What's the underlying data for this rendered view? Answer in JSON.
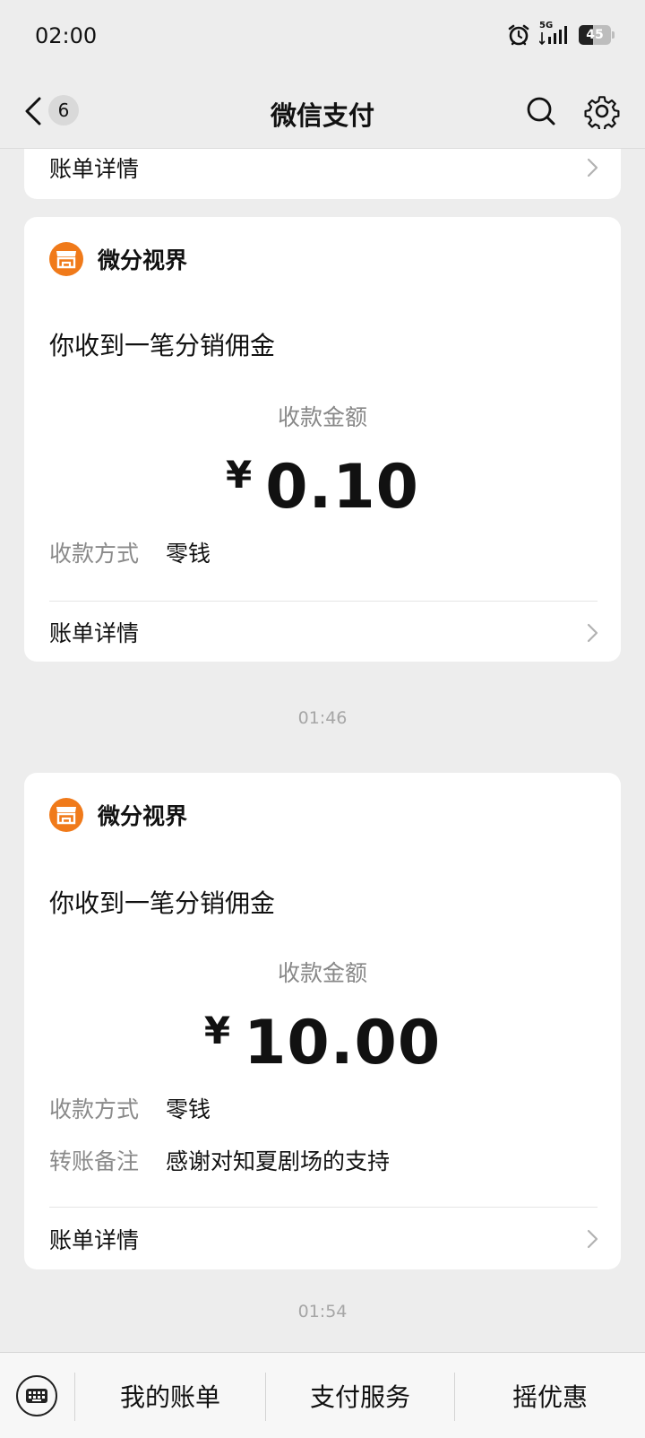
{
  "status_bar": {
    "time": "02:00",
    "network": "5G",
    "battery": "45"
  },
  "nav": {
    "back_count": "6",
    "title": "微信支付"
  },
  "cards": [
    {
      "detail_label": "账单详情"
    },
    {
      "merchant": "微分视界",
      "headline": "你收到一笔分销佣金",
      "amount_label": "收款金额",
      "currency": "¥",
      "amount": "0.10",
      "fields": [
        {
          "key": "收款方式",
          "value": "零钱"
        }
      ],
      "detail_label": "账单详情"
    },
    {
      "merchant": "微分视界",
      "headline": "你收到一笔分销佣金",
      "amount_label": "收款金额",
      "currency": "¥",
      "amount": "10.00",
      "fields": [
        {
          "key": "收款方式",
          "value": "零钱"
        },
        {
          "key": "转账备注",
          "value": "感谢对知夏剧场的支持"
        }
      ],
      "detail_label": "账单详情"
    }
  ],
  "timestamps": [
    "01:46",
    "01:54"
  ],
  "bottom_menu": [
    "我的账单",
    "支付服务",
    "摇优惠"
  ],
  "colors": {
    "background": "#ededed",
    "merchant_logo": "#f07a1a",
    "card": "#ffffff"
  },
  "icons": [
    "alarm-icon",
    "signal-icon",
    "battery-icon",
    "back-arrow-icon",
    "search-icon",
    "gear-icon",
    "store-icon",
    "chevron-right-icon",
    "keyboard-icon"
  ]
}
